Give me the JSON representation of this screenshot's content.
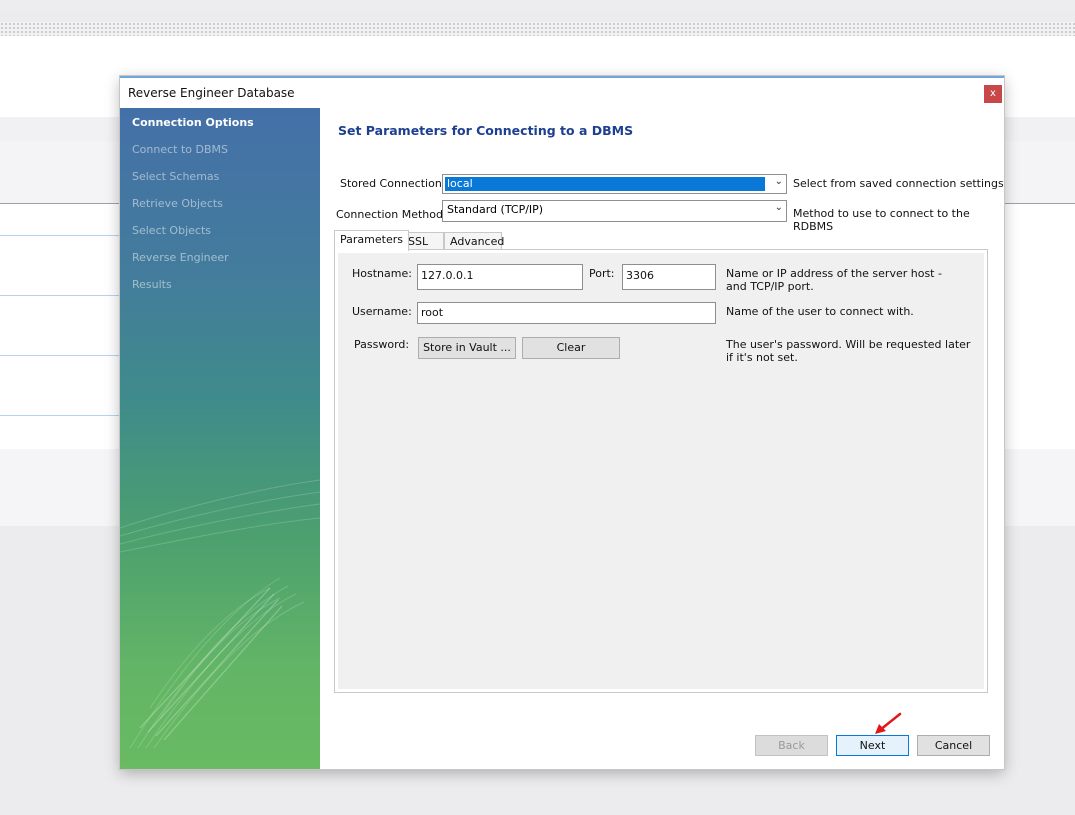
{
  "dialog": {
    "title": "Reverse Engineer Database",
    "close_label": "x"
  },
  "sidebar": {
    "steps": [
      {
        "label": "Connection Options",
        "active": true
      },
      {
        "label": "Connect to DBMS",
        "active": false
      },
      {
        "label": "Select Schemas",
        "active": false
      },
      {
        "label": "Retrieve Objects",
        "active": false
      },
      {
        "label": "Select Objects",
        "active": false
      },
      {
        "label": "Reverse Engineer",
        "active": false
      },
      {
        "label": "Results",
        "active": false
      }
    ]
  },
  "main": {
    "heading": "Set Parameters for Connecting to a DBMS",
    "stored_connection": {
      "label": "Stored Connection:",
      "value": "local",
      "hint": "Select from saved connection settings"
    },
    "connection_method": {
      "label": "Connection Method:",
      "value": "Standard (TCP/IP)",
      "hint": "Method to use to connect to the RDBMS"
    },
    "tabs": [
      {
        "label": "Parameters",
        "active": true
      },
      {
        "label": "SSL",
        "active": false
      },
      {
        "label": "Advanced",
        "active": false
      }
    ],
    "parameters": {
      "hostname_label": "Hostname:",
      "hostname_value": "127.0.0.1",
      "port_label": "Port:",
      "port_value": "3306",
      "host_hint": "Name or IP address of the server host - and TCP/IP port.",
      "username_label": "Username:",
      "username_value": "root",
      "username_hint": "Name of the user to connect with.",
      "password_label": "Password:",
      "store_vault_label": "Store in Vault ...",
      "clear_label": "Clear",
      "password_hint": "The user's password. Will be requested later if it's not set."
    }
  },
  "footer": {
    "back_label": "Back",
    "next_label": "Next",
    "cancel_label": "Cancel"
  },
  "colors": {
    "heading": "#1d3f8f",
    "selection": "#0a78d7",
    "close": "#c8484a",
    "annotation_arrow": "#e01818"
  }
}
